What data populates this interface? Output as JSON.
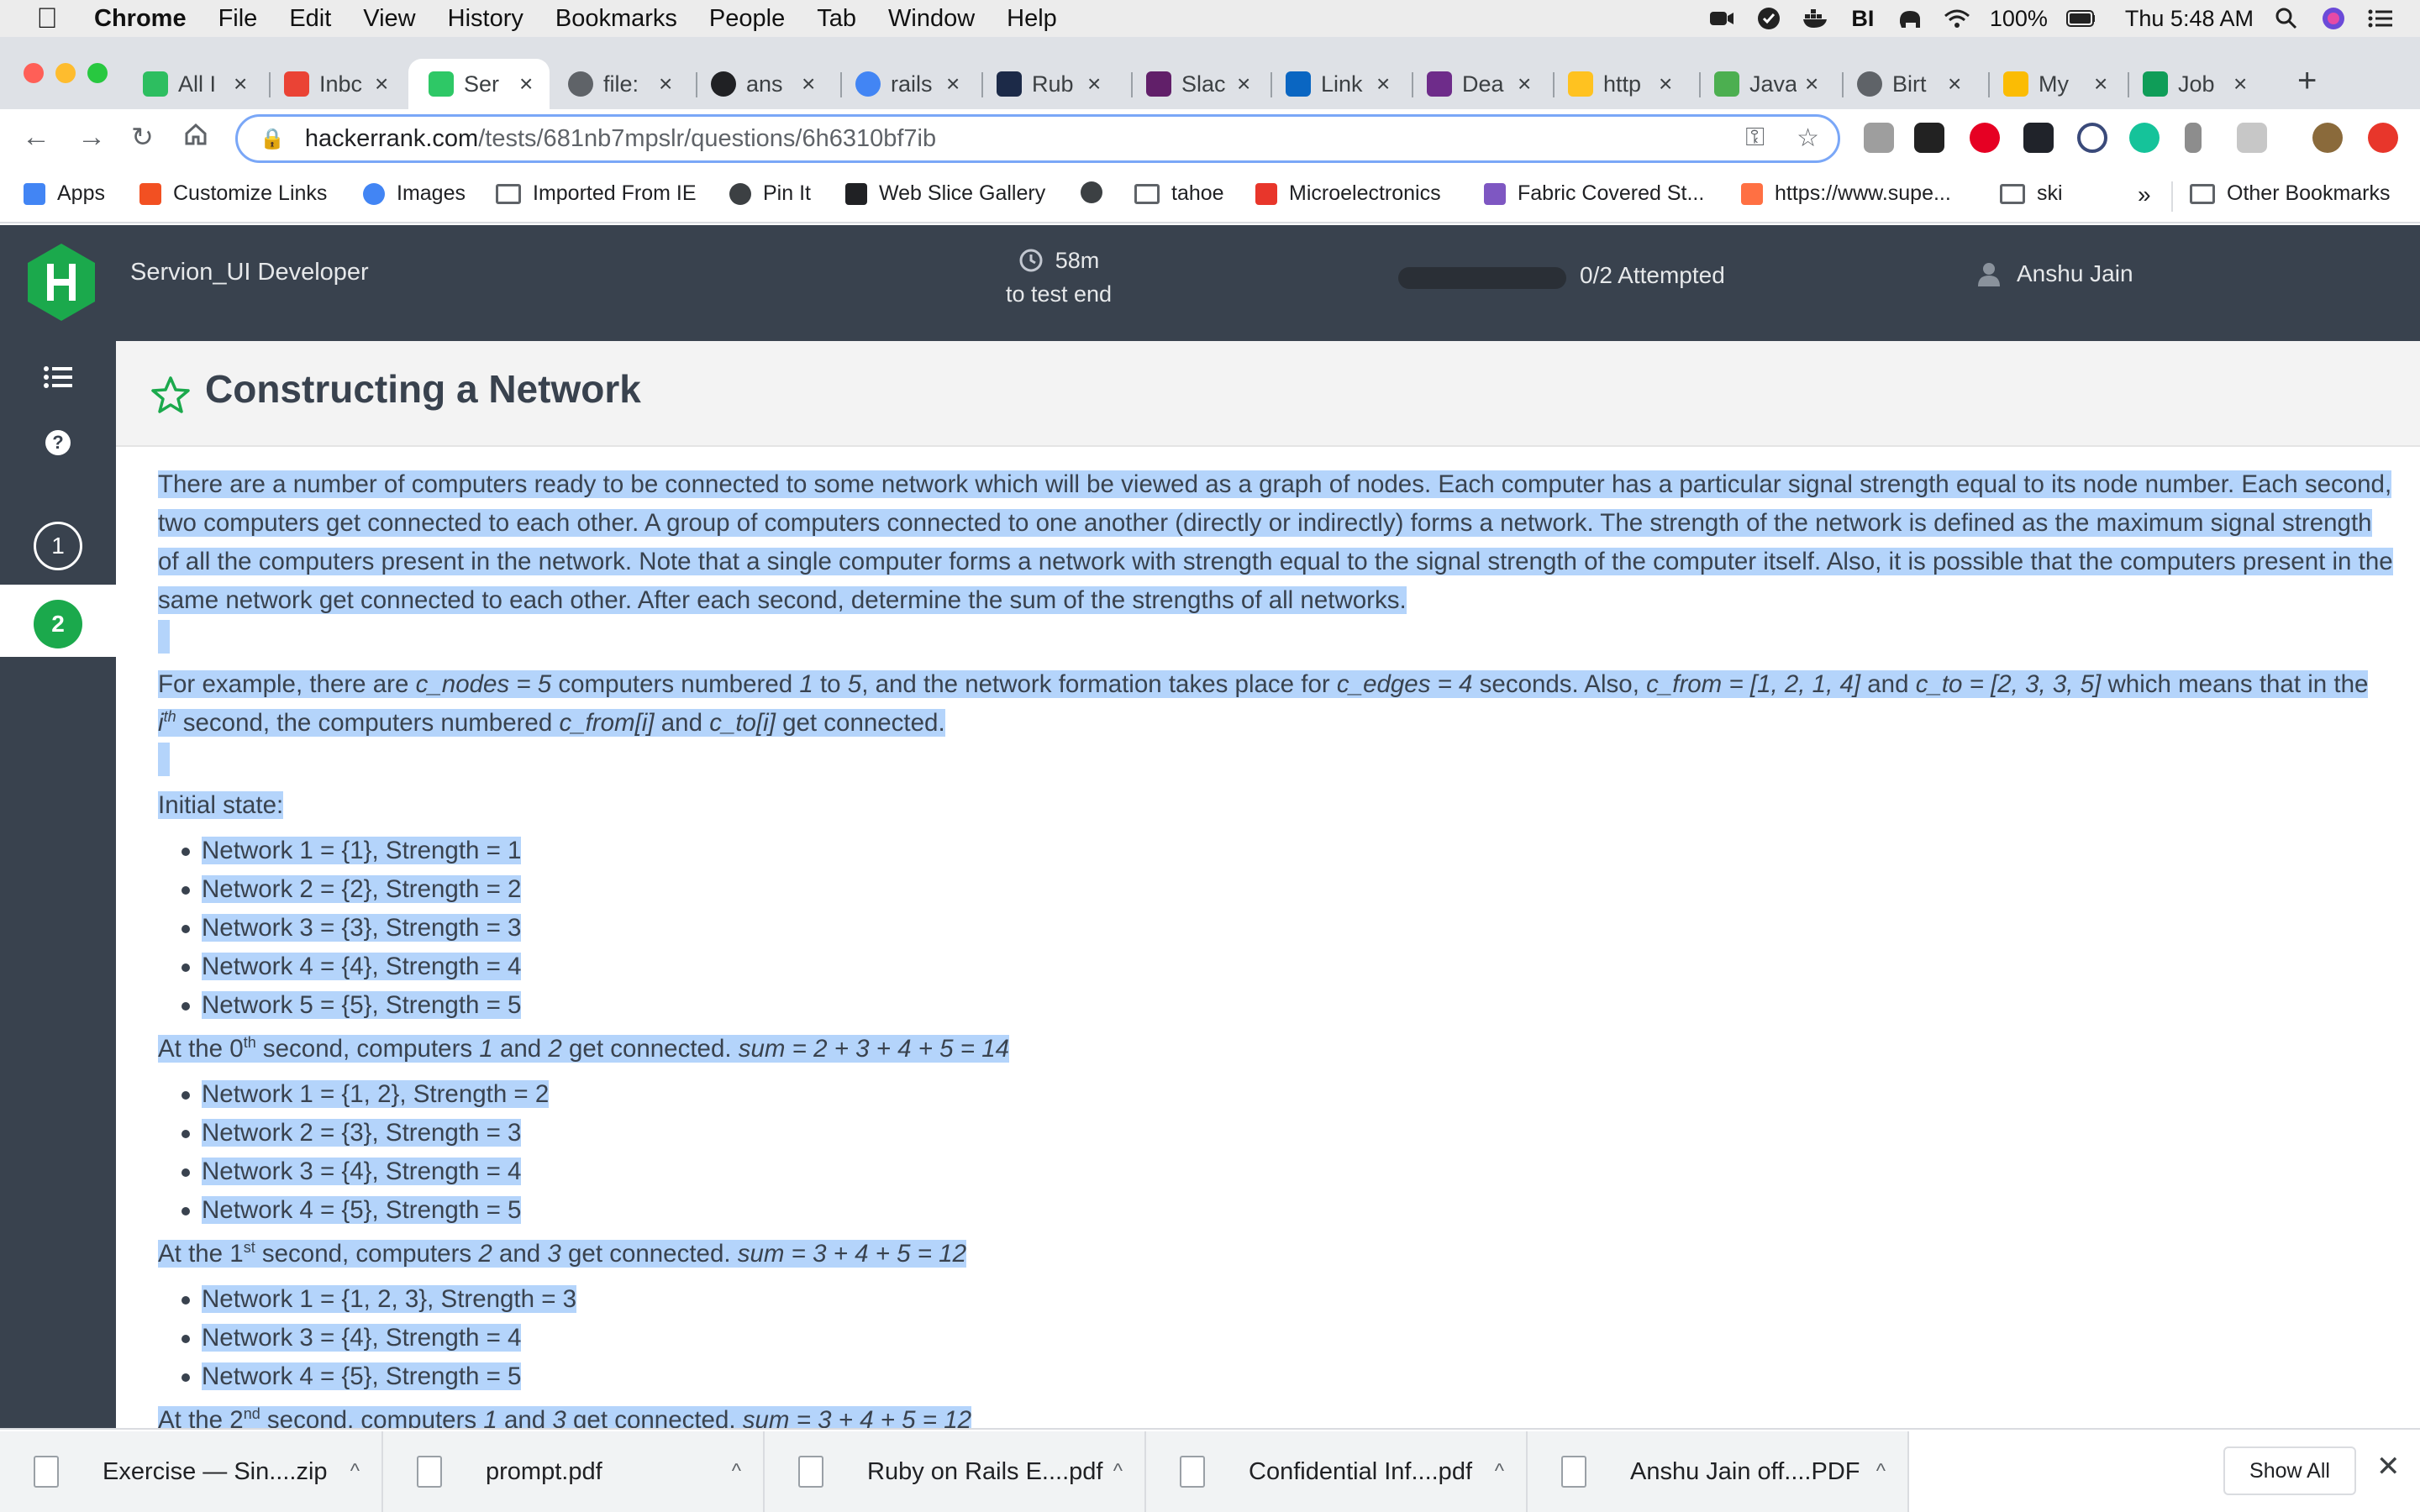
{
  "menubar": {
    "app": "Chrome",
    "items": [
      "File",
      "Edit",
      "View",
      "History",
      "Bookmarks",
      "People",
      "Tab",
      "Window",
      "Help"
    ],
    "battery": "100%",
    "clock": "Thu 5:48 AM"
  },
  "tabs": [
    {
      "label": "All I",
      "icon": "evernote-icon",
      "color": "#2dbe60"
    },
    {
      "label": "Inbc",
      "icon": "gmail-icon",
      "color": "#ea4335"
    },
    {
      "label": "Ser",
      "icon": "hackerrank-icon",
      "color": "#2ec866",
      "active": true
    },
    {
      "label": "file:",
      "icon": "globe-icon",
      "color": "#5f6368"
    },
    {
      "label": "ans",
      "icon": "github-icon",
      "color": "#202124"
    },
    {
      "label": "rails",
      "icon": "google-icon",
      "color": "#4285f4"
    },
    {
      "label": "Rub",
      "icon": "hackerrank-h-icon",
      "color": "#1c2a48"
    },
    {
      "label": "Slac",
      "icon": "slack-icon",
      "color": "#611f69"
    },
    {
      "label": "Link",
      "icon": "linkedin-icon",
      "color": "#0a66c2"
    },
    {
      "label": "Dea",
      "icon": "dp-icon",
      "color": "#6e2c8a"
    },
    {
      "label": "http",
      "icon": "walmart-icon",
      "color": "#ffc220"
    },
    {
      "label": "Java",
      "icon": "w3-icon",
      "color": "#4caf50"
    },
    {
      "label": "Birt",
      "icon": "globe-icon",
      "color": "#5f6368"
    },
    {
      "label": "My",
      "icon": "google-drive-icon",
      "color": "#fbbc04"
    },
    {
      "label": "Job",
      "icon": "sheets-icon",
      "color": "#0f9d58"
    }
  ],
  "omnibox": {
    "domain": "hackerrank.com",
    "path": "/tests/681nb7mpslr/questions/6h6310bf7ib"
  },
  "bookmarks": [
    {
      "label": "Apps",
      "icon": "apps-grid-icon"
    },
    {
      "label": "Customize Links",
      "icon": "windows-icon"
    },
    {
      "label": "Images",
      "icon": "google-icon"
    },
    {
      "label": "Imported From IE",
      "icon": "folder-icon"
    },
    {
      "label": "Pin It",
      "icon": "globe-icon"
    },
    {
      "label": "Web Slice Gallery",
      "icon": "web-slice-icon"
    },
    {
      "label": "",
      "icon": "globe-icon"
    },
    {
      "label": "tahoe",
      "icon": "folder-icon"
    },
    {
      "label": "Microelectronics",
      "icon": "oracle-icon"
    },
    {
      "label": "Fabric Covered St...",
      "icon": "fabric-icon"
    },
    {
      "label": "https://www.supe...",
      "icon": "supe-icon"
    },
    {
      "label": "ski",
      "icon": "folder-icon"
    }
  ],
  "bookmarks_overflow": "»",
  "other_bookmarks": "Other Bookmarks",
  "hr": {
    "test_name": "Servion_UI Developer",
    "timer_value": "58m",
    "timer_label": "to test end",
    "progress_fraction": 0.0,
    "attempted": "0/2 Attempted",
    "user": "Anshu Jain",
    "questions": [
      "1",
      "2"
    ],
    "active_question": "2",
    "brand_green": "#1ba94c",
    "header_bg": "#39424e"
  },
  "question": {
    "title": "Constructing a Network",
    "para1": "There are a number of computers ready to be connected to some network which will be viewed as a graph of nodes. Each computer has a particular signal strength equal to its node number. Each second, two computers get connected to each other. A group of computers connected to one another (directly or indirectly) forms a network. The strength of the network is defined as the maximum signal strength of all the computers present in the network. Note that a single computer forms a network with strength equal to the signal strength of the computer itself. Also, it is possible that the computers present in the same network get connected to each other.  After each second, determine the sum of the strengths of all networks.",
    "ex": {
      "t1": "For example, there are ",
      "v1": "c_nodes = 5",
      "t2": " computers numbered ",
      "v2": "1",
      "t3": " to ",
      "v3": "5",
      "t4": ", and the network formation takes place for ",
      "v4": "c_edges = 4",
      "t5": " seconds. Also, ",
      "v5": "c_from = [1, 2, 1, 4]",
      "t6": " and ",
      "v6": "c_to = [2, 3, 3, 5]",
      "t7": " which means that in the ",
      "v7": "i",
      "sup7": "th",
      "t8": " second, the computers numbered ",
      "v8": "c_from[i]",
      "t9": " and ",
      "v9": "c_to[i]",
      "t10": " get connected."
    },
    "initial_label": "Initial state:",
    "initial_list": [
      "Network 1 = {1}, Strength = 1",
      "Network 2 = {2}, Strength = 2",
      "Network 3 = {3}, Strength = 3",
      "Network 4 = {4}, Strength = 4",
      "Network 5 = {5}, Strength = 5"
    ],
    "steps": [
      {
        "pre": "At the 0",
        "sup": "th",
        "mid": " second, computers ",
        "a": "1",
        "and": " and ",
        "b": "2",
        "post": " get connected. ",
        "sum": "sum = 2 + 3 + 4 + 5 = 14",
        "list": [
          "Network 1 = {1, 2}, Strength = 2",
          "Network 2 = {3}, Strength = 3",
          "Network 3 = {4}, Strength = 4",
          "Network 4 = {5}, Strength = 5"
        ]
      },
      {
        "pre": "At the 1",
        "sup": "st",
        "mid": " second, computers ",
        "a": "2",
        "and": " and ",
        "b": "3",
        "post": " get connected. ",
        "sum": "sum = 3 + 4 + 5 = 12",
        "list": [
          "Network 1 = {1, 2, 3}, Strength = 3",
          "Network 3 = {4}, Strength = 4",
          "Network 4 = {5}, Strength = 5"
        ]
      },
      {
        "pre": "At the 2",
        "sup": "nd",
        "mid": " second, computers ",
        "a": "1",
        "and": " and ",
        "b": "3",
        "post": " get connected. ",
        "sum": "sum = 3 + 4 + 5 = 12",
        "list": []
      }
    ]
  },
  "downloads": [
    {
      "name": "Exercise — Sin....zip"
    },
    {
      "name": "prompt.pdf"
    },
    {
      "name": "Ruby on Rails E....pdf"
    },
    {
      "name": "Confidential Inf....pdf"
    },
    {
      "name": "Anshu Jain off....PDF"
    }
  ],
  "show_all": "Show All"
}
